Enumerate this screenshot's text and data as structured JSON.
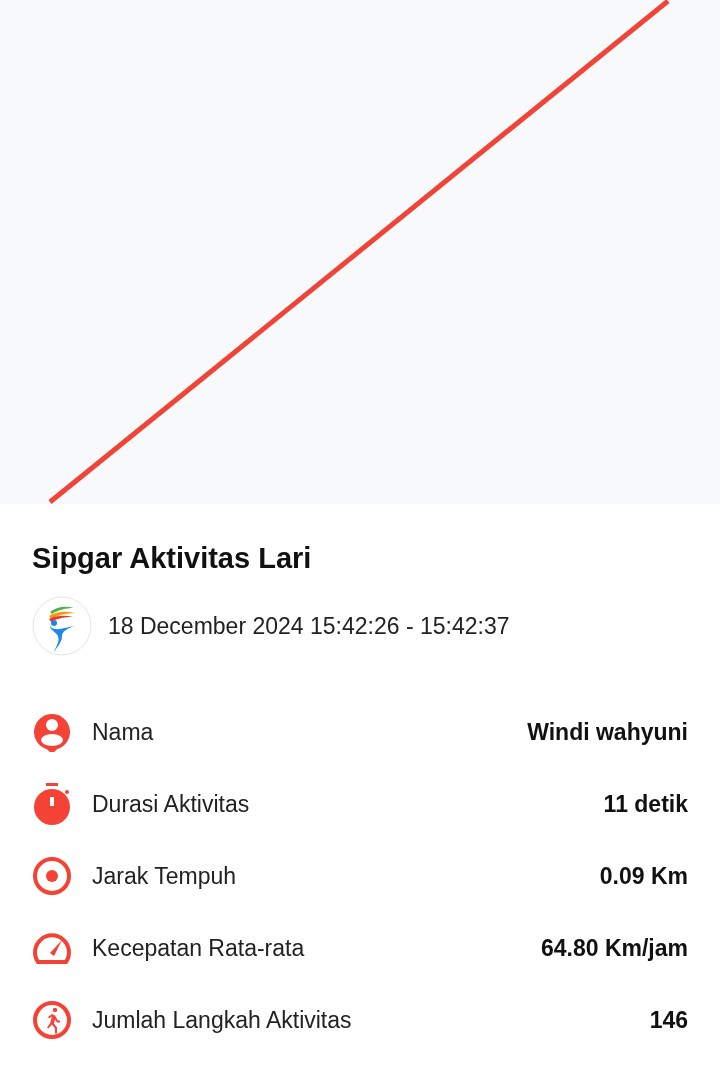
{
  "map": {
    "kind": "route"
  },
  "title": "Sipgar Aktivitas Lari",
  "session": {
    "time_range": "18 December 2024 15:42:26 - 15:42:37"
  },
  "stats": [
    {
      "kind": "person",
      "label": "Nama",
      "value": "Windi wahyuni"
    },
    {
      "kind": "stopwatch",
      "label": "Durasi Aktivitas",
      "value": "11 detik"
    },
    {
      "kind": "target",
      "label": "Jarak Tempuh",
      "value": "0.09 Km"
    },
    {
      "kind": "speedometer",
      "label": "Kecepatan Rata-rata",
      "value": "64.80 Km/jam"
    },
    {
      "kind": "runner",
      "label": "Jumlah Langkah Aktivitas",
      "value": "146"
    }
  ]
}
